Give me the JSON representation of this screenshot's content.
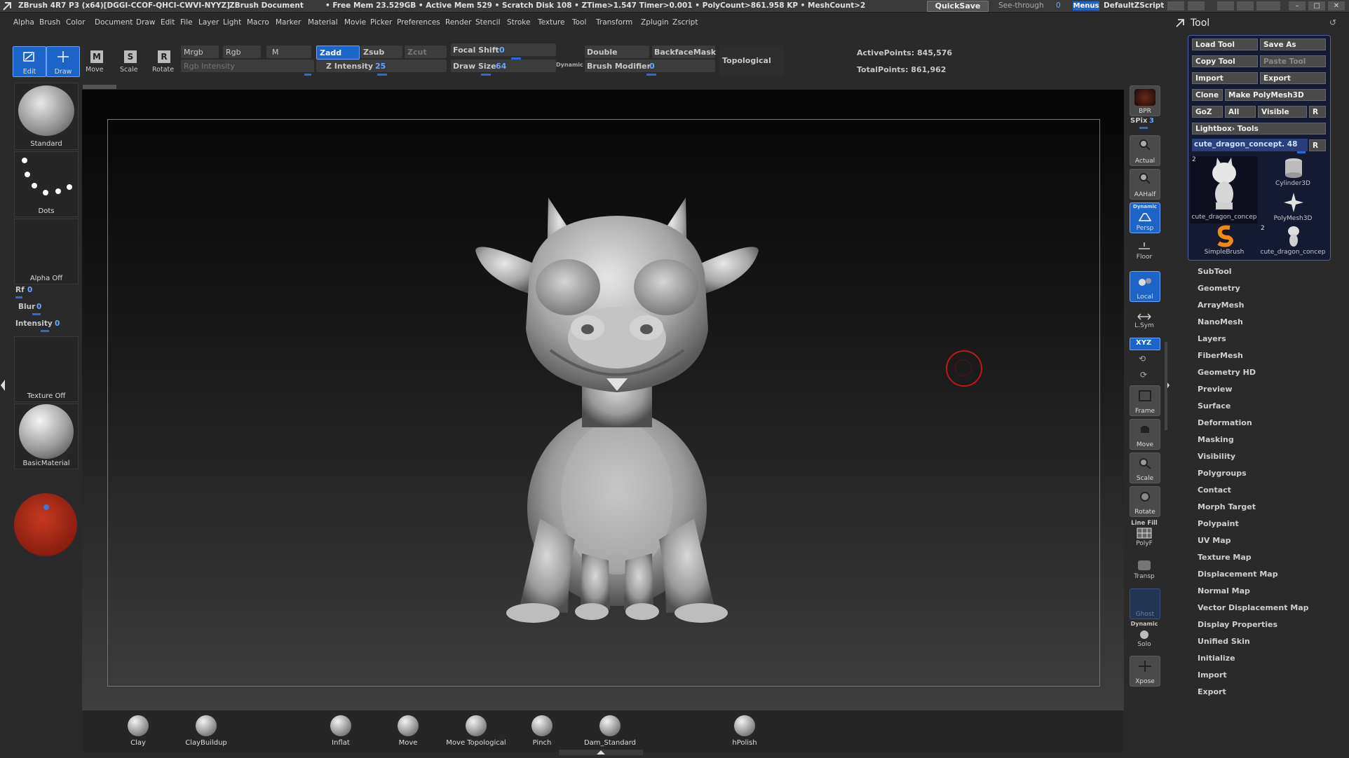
{
  "title_bar": {
    "app": "ZBrush 4R7 P3 (x64)[DGGI-CCOF-QHCI-CWVI-NYYZ]",
    "document": "ZBrush Document",
    "stats": "• Free Mem 23.529GB • Active Mem 529 • Scratch Disk 108 • ZTime>1.547 Timer>0.001 • PolyCount>861.958 KP • MeshCount>2",
    "quicksave": "QuickSave",
    "see_through": "See-through",
    "see_through_value": "0",
    "menus": "Menus",
    "default_zscript": "DefaultZScript"
  },
  "menubar": [
    "Alpha",
    "Brush",
    "Color",
    "Document",
    "Draw",
    "Edit",
    "File",
    "Layer",
    "Light",
    "Macro",
    "Marker",
    "Material",
    "Movie",
    "Picker",
    "Preferences",
    "Render",
    "Stencil",
    "Stroke",
    "Texture",
    "Tool",
    "Transform",
    "Zplugin",
    "Zscript"
  ],
  "toolbar": {
    "edit": "Edit",
    "draw": "Draw",
    "move": "Move",
    "scale": "Scale",
    "rotate": "Rotate",
    "mrgb": "Mrgb",
    "rgb": "Rgb",
    "m": "M",
    "rgb_intensity": "Rgb Intensity",
    "zadd": "Zadd",
    "zsub": "Zsub",
    "zcut": "Zcut",
    "z_intensity_label": "Z Intensity",
    "z_intensity_value": "25",
    "focal_shift_label": "Focal Shift",
    "focal_shift_value": "0",
    "draw_size_label": "Draw Size",
    "draw_size_value": "64",
    "dynamic": "Dynamic",
    "double": "Double",
    "backface_mask": "BackfaceMask",
    "brush_modifier_label": "Brush Modifier",
    "brush_modifier_value": "0",
    "topological": "Topological",
    "active_points": "ActivePoints: 845,576",
    "total_points": "TotalPoints: 861,962"
  },
  "left_shelf": {
    "brush": "Standard",
    "stroke": "Dots",
    "alpha": "Alpha  Off",
    "rf_label": "Rf",
    "rf_value": "0",
    "blur_label": "Blur",
    "blur_value": "0",
    "intensity_label": "Intensity",
    "intensity_value": "0",
    "texture": "Texture  Off",
    "material": "BasicMaterial"
  },
  "right_shelf": {
    "bpr": "BPR",
    "spix_label": "SPix",
    "spix_value": "3",
    "actual": "Actual",
    "aahalf": "AAHalf",
    "dynamic": "Dynamic",
    "persp": "Persp",
    "floor": "Floor",
    "local": "Local",
    "lsym": "L.Sym",
    "xyz": "XYZ",
    "frame": "Frame",
    "move": "Move",
    "scale": "Scale",
    "rotate": "Rotate",
    "line_fill": "Line Fill",
    "polyf": "PolyF",
    "transp": "Transp",
    "ghost": "Ghost",
    "solo_dynamic": "Dynamic",
    "solo": "Solo",
    "xpose": "Xpose"
  },
  "tool_panel": {
    "title": "Tool",
    "buttons": {
      "load_tool": "Load Tool",
      "save_as": "Save As",
      "copy_tool": "Copy Tool",
      "paste_tool": "Paste Tool",
      "import": "Import",
      "export": "Export",
      "clone": "Clone",
      "make_polymesh": "Make PolyMesh3D",
      "goz": "GoZ",
      "all": "All",
      "visible": "Visible",
      "r": "R",
      "lightbox_tools": "Lightbox› Tools"
    },
    "current_tool": "cute_dragon_concept. 48",
    "current_tool_r": "R",
    "thumbnails": [
      {
        "badge": "2",
        "label": "cute_dragon_concep"
      },
      {
        "badge": "",
        "label": "Cylinder3D"
      },
      {
        "badge": "",
        "label": "PolyMesh3D"
      },
      {
        "badge": "",
        "label": "SimpleBrush"
      },
      {
        "badge": "2",
        "label": "cute_dragon_concep"
      }
    ],
    "menu": [
      "SubTool",
      "Geometry",
      "ArrayMesh",
      "NanoMesh",
      "Layers",
      "FiberMesh",
      "Geometry HD",
      "Preview",
      "Surface",
      "Deformation",
      "Masking",
      "Visibility",
      "Polygroups",
      "Contact",
      "Morph Target",
      "Polypaint",
      "UV Map",
      "Texture Map",
      "Displacement Map",
      "Normal Map",
      "Vector Displacement Map",
      "Display Properties",
      "Unified Skin",
      "Initialize",
      "Import",
      "Export"
    ]
  },
  "bottom_shelf": {
    "brushes": [
      "Clay",
      "ClayBuildup",
      "Inflat",
      "Move",
      "Move Topological",
      "Pinch",
      "Dam_Standard",
      "hPolish"
    ]
  }
}
